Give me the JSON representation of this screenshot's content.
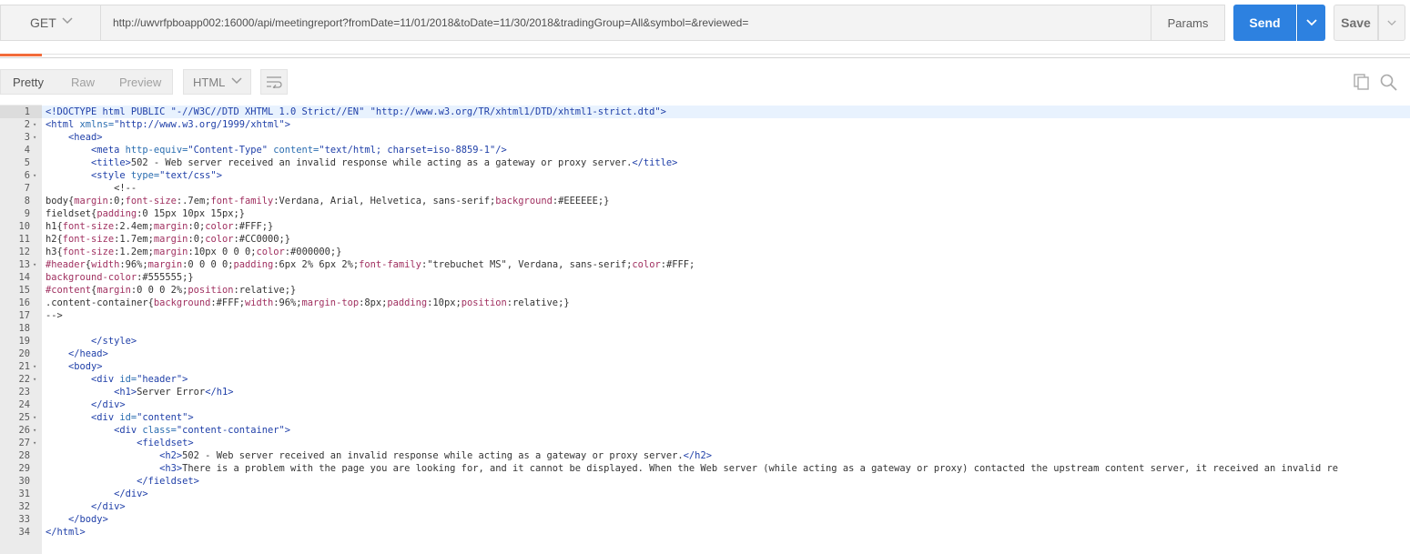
{
  "request": {
    "method": "GET",
    "url": "http://uwvrfpboapp002:16000/api/meetingreport?fromDate=11/01/2018&toDate=11/30/2018&tradingGroup=All&symbol=&reviewed=",
    "params_label": "Params",
    "send_label": "Send",
    "save_label": "Save"
  },
  "response": {
    "tabs": [
      "Pretty",
      "Raw",
      "Preview"
    ],
    "active_tab": "Pretty",
    "format": "HTML"
  },
  "editor": {
    "active_line": 1,
    "lines": [
      {
        "n": "1",
        "fold": false,
        "segs": [
          [
            "tag",
            "<!DOCTYPE html PUBLIC \"-//W3C//DTD XHTML 1.0 Strict//EN\" \"http://www.w3.org/TR/xhtml1/DTD/xhtml1-strict.dtd\">"
          ]
        ]
      },
      {
        "n": "2",
        "fold": true,
        "segs": [
          [
            "tag",
            "<html "
          ],
          [
            "attr",
            "xmlns="
          ],
          [
            "val",
            "\"http://www.w3.org/1999/xhtml\""
          ],
          [
            "tag",
            ">"
          ]
        ]
      },
      {
        "n": "3",
        "fold": true,
        "segs": [
          [
            "plain",
            "    "
          ],
          [
            "tag",
            "<head>"
          ]
        ]
      },
      {
        "n": "4",
        "fold": false,
        "segs": [
          [
            "plain",
            "        "
          ],
          [
            "tag",
            "<meta "
          ],
          [
            "attr",
            "http-equiv="
          ],
          [
            "val",
            "\"Content-Type\""
          ],
          [
            "attr",
            " content="
          ],
          [
            "val",
            "\"text/html; charset=iso-8859-1\""
          ],
          [
            "tag",
            "/>"
          ]
        ]
      },
      {
        "n": "5",
        "fold": false,
        "segs": [
          [
            "plain",
            "        "
          ],
          [
            "tag",
            "<title>"
          ],
          [
            "plain",
            "502 - Web server received an invalid response while acting as a gateway or proxy server."
          ],
          [
            "tag",
            "</title>"
          ]
        ]
      },
      {
        "n": "6",
        "fold": true,
        "segs": [
          [
            "plain",
            "        "
          ],
          [
            "tag",
            "<style "
          ],
          [
            "attr",
            "type="
          ],
          [
            "val",
            "\"text/css\""
          ],
          [
            "tag",
            ">"
          ]
        ]
      },
      {
        "n": "7",
        "fold": false,
        "segs": [
          [
            "plain",
            "            <!--"
          ]
        ]
      },
      {
        "n": "8",
        "fold": false,
        "segs": [
          [
            "plain",
            "body{"
          ],
          [
            "prop",
            "margin"
          ],
          [
            "plain",
            ":0;"
          ],
          [
            "prop",
            "font-size"
          ],
          [
            "plain",
            ":.7em;"
          ],
          [
            "prop",
            "font-family"
          ],
          [
            "plain",
            ":Verdana, Arial, Helvetica, sans-serif;"
          ],
          [
            "prop",
            "background"
          ],
          [
            "plain",
            ":#EEEEEE;}"
          ]
        ]
      },
      {
        "n": "9",
        "fold": false,
        "segs": [
          [
            "plain",
            "fieldset{"
          ],
          [
            "prop",
            "padding"
          ],
          [
            "plain",
            ":0 15px 10px 15px;}"
          ]
        ]
      },
      {
        "n": "10",
        "fold": false,
        "segs": [
          [
            "plain",
            "h1{"
          ],
          [
            "prop",
            "font-size"
          ],
          [
            "plain",
            ":2.4em;"
          ],
          [
            "prop",
            "margin"
          ],
          [
            "plain",
            ":0;"
          ],
          [
            "prop",
            "color"
          ],
          [
            "plain",
            ":#FFF;}"
          ]
        ]
      },
      {
        "n": "11",
        "fold": false,
        "segs": [
          [
            "plain",
            "h2{"
          ],
          [
            "prop",
            "font-size"
          ],
          [
            "plain",
            ":1.7em;"
          ],
          [
            "prop",
            "margin"
          ],
          [
            "plain",
            ":0;"
          ],
          [
            "prop",
            "color"
          ],
          [
            "plain",
            ":#CC0000;}"
          ]
        ]
      },
      {
        "n": "12",
        "fold": false,
        "segs": [
          [
            "plain",
            "h3{"
          ],
          [
            "prop",
            "font-size"
          ],
          [
            "plain",
            ":1.2em;"
          ],
          [
            "prop",
            "margin"
          ],
          [
            "plain",
            ":10px 0 0 0;"
          ],
          [
            "prop",
            "color"
          ],
          [
            "plain",
            ":#000000;}"
          ]
        ]
      },
      {
        "n": "13",
        "fold": true,
        "segs": [
          [
            "prop",
            "#header"
          ],
          [
            "plain",
            "{"
          ],
          [
            "prop",
            "width"
          ],
          [
            "plain",
            ":96%;"
          ],
          [
            "prop",
            "margin"
          ],
          [
            "plain",
            ":0 0 0 0;"
          ],
          [
            "prop",
            "padding"
          ],
          [
            "plain",
            ":6px 2% 6px 2%;"
          ],
          [
            "prop",
            "font-family"
          ],
          [
            "plain",
            ":\"trebuchet MS\", Verdana, sans-serif;"
          ],
          [
            "prop",
            "color"
          ],
          [
            "plain",
            ":#FFF;"
          ]
        ]
      },
      {
        "n": "14",
        "fold": false,
        "segs": [
          [
            "prop",
            "background-color"
          ],
          [
            "plain",
            ":#555555;}"
          ]
        ]
      },
      {
        "n": "15",
        "fold": false,
        "segs": [
          [
            "prop",
            "#content"
          ],
          [
            "plain",
            "{"
          ],
          [
            "prop",
            "margin"
          ],
          [
            "plain",
            ":0 0 0 2%;"
          ],
          [
            "prop",
            "position"
          ],
          [
            "plain",
            ":relative;}"
          ]
        ]
      },
      {
        "n": "16",
        "fold": false,
        "segs": [
          [
            "plain",
            ".content-container{"
          ],
          [
            "prop",
            "background"
          ],
          [
            "plain",
            ":#FFF;"
          ],
          [
            "prop",
            "width"
          ],
          [
            "plain",
            ":96%;"
          ],
          [
            "prop",
            "margin-top"
          ],
          [
            "plain",
            ":8px;"
          ],
          [
            "prop",
            "padding"
          ],
          [
            "plain",
            ":10px;"
          ],
          [
            "prop",
            "position"
          ],
          [
            "plain",
            ":relative;}"
          ]
        ]
      },
      {
        "n": "17",
        "fold": false,
        "segs": [
          [
            "plain",
            "-->"
          ]
        ]
      },
      {
        "n": "18",
        "fold": false,
        "segs": [
          [
            "plain",
            ""
          ]
        ]
      },
      {
        "n": "19",
        "fold": false,
        "segs": [
          [
            "plain",
            "        "
          ],
          [
            "tag",
            "</style>"
          ]
        ]
      },
      {
        "n": "20",
        "fold": false,
        "segs": [
          [
            "plain",
            "    "
          ],
          [
            "tag",
            "</head>"
          ]
        ]
      },
      {
        "n": "21",
        "fold": true,
        "segs": [
          [
            "plain",
            "    "
          ],
          [
            "tag",
            "<body>"
          ]
        ]
      },
      {
        "n": "22",
        "fold": true,
        "segs": [
          [
            "plain",
            "        "
          ],
          [
            "tag",
            "<div "
          ],
          [
            "attr",
            "id="
          ],
          [
            "val",
            "\"header\""
          ],
          [
            "tag",
            ">"
          ]
        ]
      },
      {
        "n": "23",
        "fold": false,
        "segs": [
          [
            "plain",
            "            "
          ],
          [
            "tag",
            "<h1>"
          ],
          [
            "plain",
            "Server Error"
          ],
          [
            "tag",
            "</h1>"
          ]
        ]
      },
      {
        "n": "24",
        "fold": false,
        "segs": [
          [
            "plain",
            "        "
          ],
          [
            "tag",
            "</div>"
          ]
        ]
      },
      {
        "n": "25",
        "fold": true,
        "segs": [
          [
            "plain",
            "        "
          ],
          [
            "tag",
            "<div "
          ],
          [
            "attr",
            "id="
          ],
          [
            "val",
            "\"content\""
          ],
          [
            "tag",
            ">"
          ]
        ]
      },
      {
        "n": "26",
        "fold": true,
        "segs": [
          [
            "plain",
            "            "
          ],
          [
            "tag",
            "<div "
          ],
          [
            "attr",
            "class="
          ],
          [
            "val",
            "\"content-container\""
          ],
          [
            "tag",
            ">"
          ]
        ]
      },
      {
        "n": "27",
        "fold": true,
        "segs": [
          [
            "plain",
            "                "
          ],
          [
            "tag",
            "<fieldset>"
          ]
        ]
      },
      {
        "n": "28",
        "fold": false,
        "segs": [
          [
            "plain",
            "                    "
          ],
          [
            "tag",
            "<h2>"
          ],
          [
            "plain",
            "502 - Web server received an invalid response while acting as a gateway or proxy server."
          ],
          [
            "tag",
            "</h2>"
          ]
        ]
      },
      {
        "n": "29",
        "fold": false,
        "segs": [
          [
            "plain",
            "                    "
          ],
          [
            "tag",
            "<h3>"
          ],
          [
            "plain",
            "There is a problem with the page you are looking for, and it cannot be displayed. When the Web server (while acting as a gateway or proxy) contacted the upstream content server, it received an invalid re"
          ]
        ]
      },
      {
        "n": "30",
        "fold": false,
        "segs": [
          [
            "plain",
            "                "
          ],
          [
            "tag",
            "</fieldset>"
          ]
        ]
      },
      {
        "n": "31",
        "fold": false,
        "segs": [
          [
            "plain",
            "            "
          ],
          [
            "tag",
            "</div>"
          ]
        ]
      },
      {
        "n": "32",
        "fold": false,
        "segs": [
          [
            "plain",
            "        "
          ],
          [
            "tag",
            "</div>"
          ]
        ]
      },
      {
        "n": "33",
        "fold": false,
        "segs": [
          [
            "plain",
            "    "
          ],
          [
            "tag",
            "</body>"
          ]
        ]
      },
      {
        "n": "34",
        "fold": false,
        "segs": [
          [
            "tag",
            "</html>"
          ]
        ]
      }
    ]
  },
  "colors": {
    "send_button": "#2d81e0",
    "active_tab_underline": "#f26b3a",
    "tag": "#1f3fa8",
    "css_property": "#a03060"
  },
  "icons": [
    "chevron-down-icon",
    "wrap-lines-icon",
    "copy-icon",
    "search-icon"
  ]
}
